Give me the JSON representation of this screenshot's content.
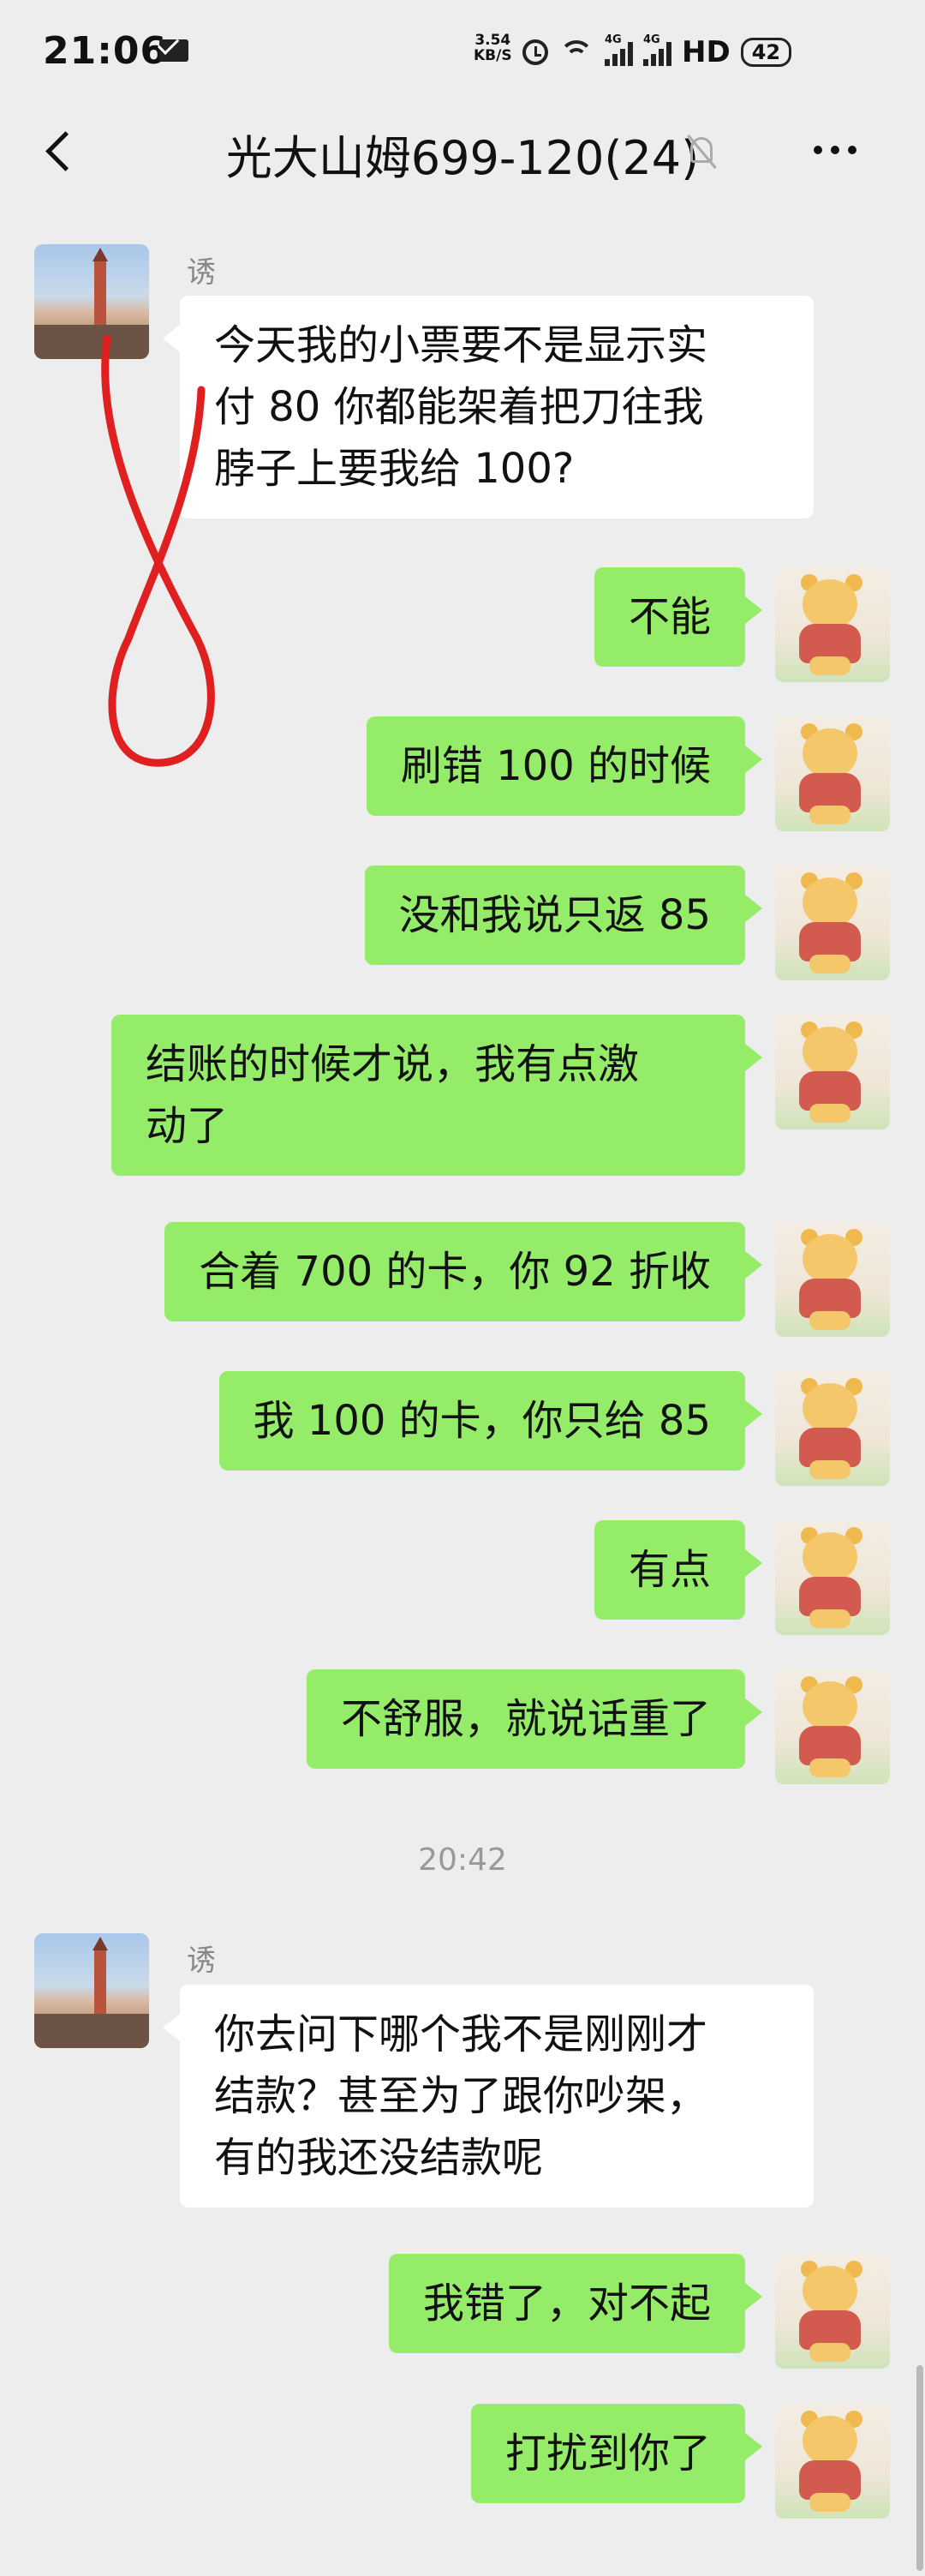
{
  "status_bar": {
    "time": "21:06",
    "net_speed_value": "3.54",
    "net_speed_unit": "KB/S",
    "network_1": "4G",
    "network_2": "4G",
    "hd": "HD",
    "battery": "42"
  },
  "header": {
    "title": "光大山姆699-120(24)"
  },
  "messages": [
    {
      "side": "in",
      "sender": "诱",
      "text": "今天我的小票要不是显示实\n付 80 你都能架着把刀往我\n脖子上要我给 100?"
    },
    {
      "side": "out",
      "text": "不能"
    },
    {
      "side": "out",
      "text": "刷错 100 的时候"
    },
    {
      "side": "out",
      "text": "没和我说只返 85"
    },
    {
      "side": "out",
      "text": "结账的时候才说，我有点激\n动了"
    },
    {
      "side": "out",
      "text": "合着 700 的卡，你 92 折收"
    },
    {
      "side": "out",
      "text": "我 100 的卡，你只给 85"
    },
    {
      "side": "out",
      "text": "有点"
    },
    {
      "side": "out",
      "text": "不舒服，就说话重了"
    },
    {
      "side": "in",
      "sender": "诱",
      "text": "你去问下哪个我不是刚刚才\n结款？甚至为了跟你吵架，\n有的我还没结款呢"
    },
    {
      "side": "out",
      "text": "我错了，对不起"
    },
    {
      "side": "out",
      "text": "打扰到你了"
    }
  ],
  "timestamp": "20:42",
  "colors": {
    "background": "#EDEDED",
    "outgoing_bubble": "#95EC69",
    "incoming_bubble": "#FFFFFF",
    "annotation": "#E02020"
  },
  "icons": {
    "back": "chevron-left-icon",
    "mute": "bell-slash-icon",
    "more": "more-dots-icon"
  }
}
